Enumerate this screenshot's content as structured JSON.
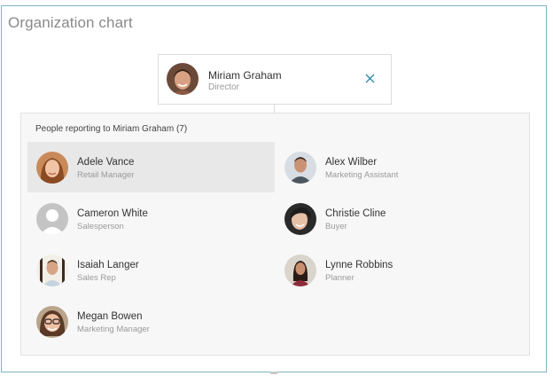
{
  "title": "Organization chart",
  "manager": {
    "name": "Miriam Graham",
    "role": "Director",
    "avatar": "avatar-miriam-graham"
  },
  "close_icon": "close-icon",
  "reports_heading": "People reporting to Miriam Graham (7)",
  "colors": {
    "frame_border": "#7fb3c4",
    "accent": "#2b88a8",
    "panel_bg": "#f7f7f7",
    "selected_bg": "#e8e8e8"
  },
  "reports": [
    {
      "name": "Adele Vance",
      "role": "Retail Manager",
      "selected": true
    },
    {
      "name": "Alex Wilber",
      "role": "Marketing Assistant",
      "selected": false
    },
    {
      "name": "Cameron White",
      "role": "Salesperson",
      "selected": false
    },
    {
      "name": "Christie Cline",
      "role": "Buyer",
      "selected": false
    },
    {
      "name": "Isaiah Langer",
      "role": "Sales Rep",
      "selected": false
    },
    {
      "name": "Lynne Robbins",
      "role": "Planner",
      "selected": false
    },
    {
      "name": "Megan Bowen",
      "role": "Marketing Manager",
      "selected": false
    }
  ]
}
